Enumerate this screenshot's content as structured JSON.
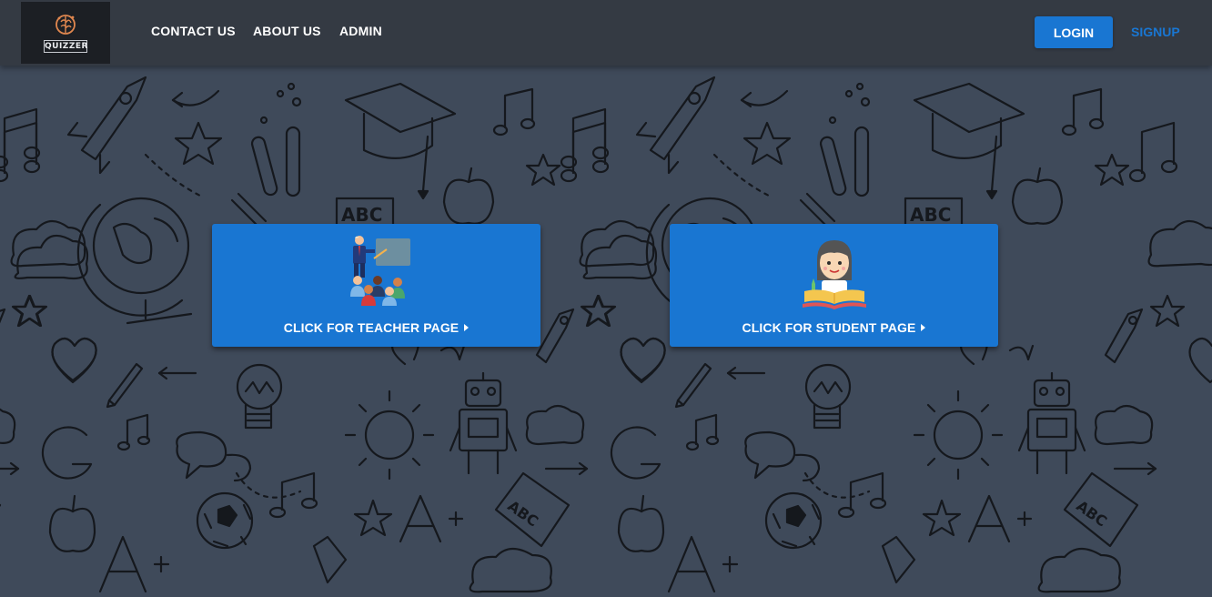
{
  "brand": {
    "logo_text": "QUIZZER",
    "logo_icon": "brain-icon"
  },
  "nav": {
    "links": [
      "CONTACT US",
      "ABOUT US",
      "ADMIN"
    ],
    "login_label": "LOGIN",
    "signup_label": "SIGNUP"
  },
  "cards": [
    {
      "label": "CLICK FOR TEACHER PAGE",
      "icon": "teacher-classroom-icon",
      "arrow": "play-arrow-icon"
    },
    {
      "label": "CLICK FOR STUDENT PAGE",
      "icon": "student-reading-icon",
      "arrow": "play-arrow-icon"
    }
  ],
  "colors": {
    "background": "#3f4a5a",
    "navbar": "#343a43",
    "accent": "#1976d2",
    "doodle": "#15181d"
  }
}
